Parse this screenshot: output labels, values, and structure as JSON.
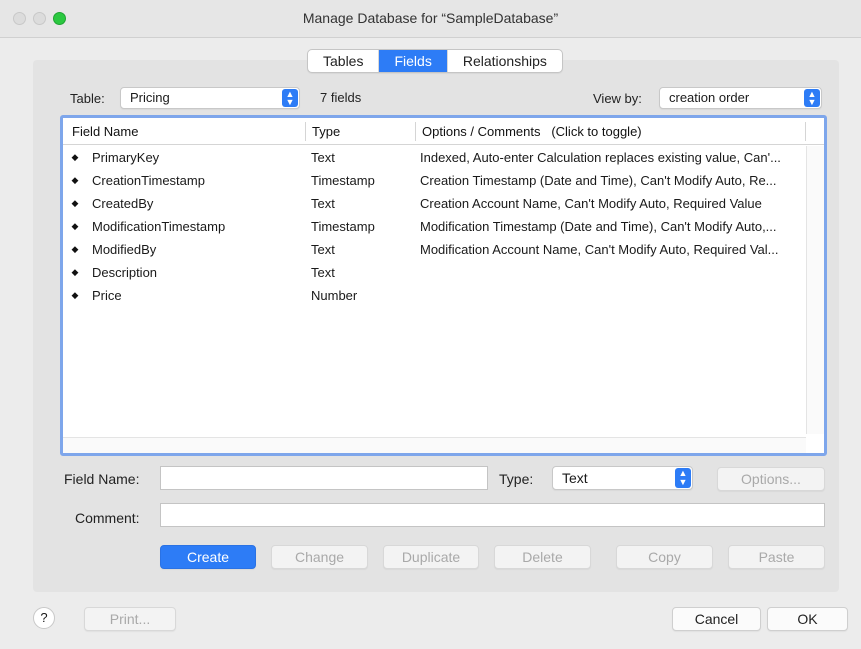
{
  "window": {
    "title": "Manage Database for “SampleDatabase”"
  },
  "tabs": [
    {
      "label": "Tables",
      "active": false
    },
    {
      "label": "Fields",
      "active": true
    },
    {
      "label": "Relationships",
      "active": false
    }
  ],
  "toolbar": {
    "table_label": "Table:",
    "table_value": "Pricing",
    "field_count": "7 fields",
    "view_by_label": "View by:",
    "view_by_value": "creation order"
  },
  "table": {
    "columns": [
      "Field Name",
      "Type",
      "Options / Comments   (Click to toggle)"
    ],
    "rows": [
      {
        "name": "PrimaryKey",
        "type": "Text",
        "options": "Indexed, Auto-enter Calculation replaces existing value, Can'..."
      },
      {
        "name": "CreationTimestamp",
        "type": "Timestamp",
        "options": "Creation Timestamp (Date and Time), Can't Modify Auto, Re..."
      },
      {
        "name": "CreatedBy",
        "type": "Text",
        "options": "Creation Account Name, Can't Modify Auto, Required Value"
      },
      {
        "name": "ModificationTimestamp",
        "type": "Timestamp",
        "options": "Modification Timestamp (Date and Time), Can't Modify Auto,..."
      },
      {
        "name": "ModifiedBy",
        "type": "Text",
        "options": "Modification Account Name, Can't Modify Auto, Required Val..."
      },
      {
        "name": "Description",
        "type": "Text",
        "options": ""
      },
      {
        "name": "Price",
        "type": "Number",
        "options": ""
      }
    ]
  },
  "form": {
    "field_name_label": "Field Name:",
    "field_name_value": "",
    "type_label": "Type:",
    "type_value": "Text",
    "options_button": "Options...",
    "comment_label": "Comment:",
    "comment_value": ""
  },
  "actions": {
    "create": "Create",
    "change": "Change",
    "duplicate": "Duplicate",
    "delete": "Delete",
    "copy": "Copy",
    "paste": "Paste"
  },
  "footer": {
    "help": "?",
    "print": "Print...",
    "cancel": "Cancel",
    "ok": "OK"
  },
  "colors": {
    "accent": "#2d7cf6",
    "table_focus_ring": "#7ea6eb",
    "zoom_button": "#2bc840"
  },
  "icons": {
    "popup_arrows": "up-down-chevron-icon",
    "row_handle": "drag-handle-icon",
    "help": "question-mark-icon"
  }
}
